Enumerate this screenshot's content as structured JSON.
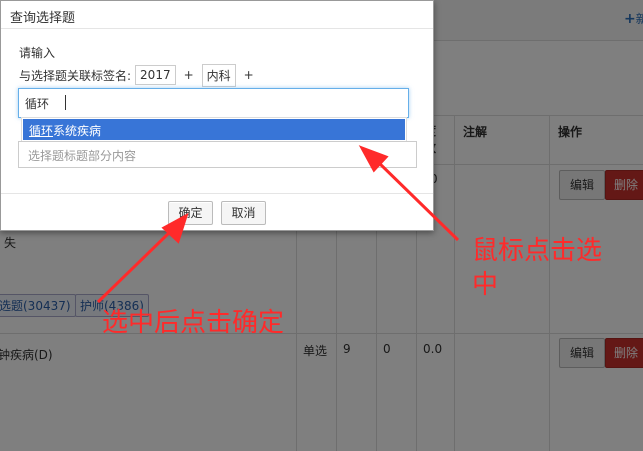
{
  "background": {
    "top_right_plus": "+",
    "top_right_text": "新",
    "headers": {
      "difficulty": "度\n数",
      "note": "注解",
      "action": "操作"
    },
    "row1": {
      "col_zero": "0",
      "partial_text": "失",
      "tags": [
        "选题(30437)",
        "护师(4386)"
      ],
      "edit_label": "编辑",
      "delete_label": "删除"
    },
    "row2": {
      "title": "钟疾病(D)",
      "type": "单选",
      "v1": "9",
      "v2": "0",
      "v3": "0.0",
      "edit_label": "编辑",
      "delete_label": "删除"
    }
  },
  "modal": {
    "title": "查询选择题",
    "prompt": "请输入",
    "tag_label": "与选择题关联标签名:",
    "tags": [
      "2017",
      "内科"
    ],
    "tag_plus": "+",
    "search_value": "循环",
    "suggestion_match": "循环",
    "suggestion_rest": "系统疾病",
    "title_placeholder": "选择题标题部分内容",
    "confirm_label": "确定",
    "cancel_label": "取消"
  },
  "annotations": {
    "click_option_line1": "鼠标点击选",
    "click_option_line2": "中",
    "click_confirm": "选中后点击确定",
    "color": "#ff2a2a"
  },
  "colors": {
    "highlight": "#3875d7",
    "delete_button": "#c9302c",
    "focus_border": "#66afe9"
  }
}
